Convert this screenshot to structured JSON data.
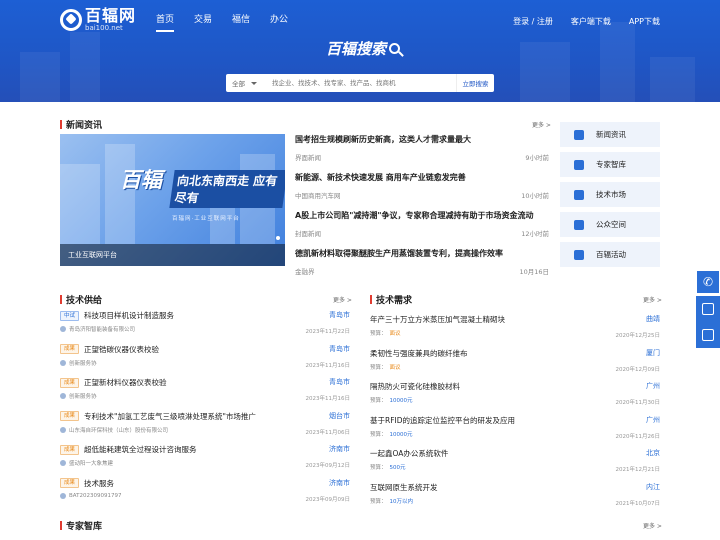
{
  "header": {
    "logo_text": "百辐网",
    "logo_sub": "bai100.net",
    "nav": [
      "首页",
      "交易",
      "福信",
      "办公"
    ],
    "login": "登录 / 注册",
    "client": "客户端下载",
    "app": "APP下载",
    "center_brand": "百辐搜索",
    "search": {
      "category": "全部",
      "placeholder": "找企业、找技术、找专家、找产品、找商机",
      "button": "立即搜索"
    }
  },
  "news": {
    "title": "新闻资讯",
    "more": "更多 >",
    "banner": {
      "big": "百辐",
      "slogan": "向北东南西走 应有尽有",
      "sub": "百辐网·工业互联网平台",
      "caption": "工业互联网平台"
    },
    "items": [
      {
        "title": "国考招生规模刷新历史新高，这类人才需求量最大",
        "source": "界面新闻",
        "time": "9小时前"
      },
      {
        "title": "新能源、新技术快速发展 商用车产业链愈发完善",
        "source": "中国商用汽车网",
        "time": "10小时前"
      },
      {
        "title": "A股上市公司陷\"减持潮\"争议，专家称合理减持有助于市场资金流动",
        "source": "封面新闻",
        "time": "12小时前"
      },
      {
        "title": "德凯新材料取得聚醚胺生产用蒸馏装置专利，提高操作效率",
        "source": "金融界",
        "time": "10月16日"
      }
    ]
  },
  "side_nav": [
    "新闻资讯",
    "专家智库",
    "技术市场",
    "公众空间",
    "百辐活动"
  ],
  "supply": {
    "title": "技术供给",
    "more": "更多 >",
    "items": [
      {
        "tag": "中试",
        "tag_color": "blue",
        "title": "科技项目样机设计制造服务",
        "city": "青岛市",
        "org": "青岛济阳智能装备有限公司",
        "date": "2023年11月22日"
      },
      {
        "tag": "成果",
        "tag_color": "orange",
        "title": "正望锆碳仪器仪表校验",
        "city": "青岛市",
        "org": "创新服务协",
        "date": "2023年11月16日"
      },
      {
        "tag": "成果",
        "tag_color": "orange",
        "title": "正望新材料仪器仪表校验",
        "city": "青岛市",
        "org": "创新服务协",
        "date": "2023年11月16日"
      },
      {
        "tag": "成果",
        "tag_color": "orange",
        "title": "专利技术\"加氢工艺废气三级喷淋处理系统\"市场推广",
        "city": "烟台市",
        "org": "山东海自环保科技（山东）股份有限公司",
        "date": "2023年11月06日"
      },
      {
        "tag": "成果",
        "tag_color": "orange",
        "title": "超低能耗建筑全过程设计咨询服务",
        "city": "济南市",
        "org": "盛动阳一大象焦建",
        "date": "2023年09月12日"
      },
      {
        "tag": "成果",
        "tag_color": "orange",
        "title": "技术服务",
        "city": "济南市",
        "org": "BAT202309091797",
        "date": "2023年09月09日"
      }
    ]
  },
  "demand": {
    "title": "技术需求",
    "more": "更多 >",
    "budget_label": "预算：",
    "items": [
      {
        "title": "年产三十万立方米蒸压加气混凝土精砌块",
        "city": "曲靖",
        "budget": "面议",
        "date": "2020年12月25日"
      },
      {
        "title": "柔韧性与强度兼具的碳纤维布",
        "city": "厦门",
        "budget": "面议",
        "date": "2020年12月09日"
      },
      {
        "title": "隔热防火可瓷化硅橡胶材料",
        "city": "广州",
        "budget": "10000元",
        "date": "2020年11月30日"
      },
      {
        "title": "基于RFID的追踪定位监控平台的研发及应用",
        "city": "广州",
        "budget": "10000元",
        "date": "2020年11月26日"
      },
      {
        "title": "一起鑫OA办公系统软件",
        "city": "北京",
        "budget": "500元",
        "date": "2021年12月21日"
      },
      {
        "title": "互联网原生系统开发",
        "city": "内江",
        "budget": "10万以内",
        "date": "2021年10月07日"
      }
    ]
  },
  "experts": {
    "title": "专家智库",
    "more": "更多 >"
  }
}
